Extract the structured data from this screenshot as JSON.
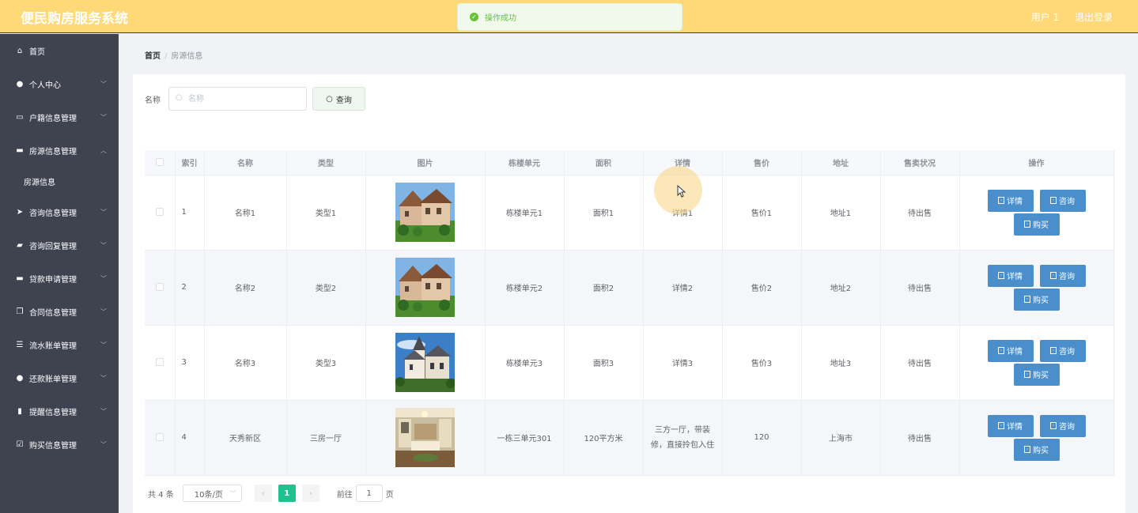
{
  "header": {
    "brand": "便民购房服务系统",
    "user": "用户 1",
    "logout": "退出登录"
  },
  "toast": {
    "message": "操作成功"
  },
  "sidebar": {
    "items": [
      {
        "label": "首页",
        "icon": "home-icon"
      },
      {
        "label": "个人中心",
        "icon": "user-icon"
      },
      {
        "label": "户籍信息管理",
        "icon": "chat-icon"
      },
      {
        "label": "房源信息管理",
        "icon": "monitor-icon",
        "expanded": true,
        "children": [
          "房源信息"
        ]
      },
      {
        "label": "咨询信息管理",
        "icon": "send-icon"
      },
      {
        "label": "咨询回复管理",
        "icon": "reply-icon"
      },
      {
        "label": "贷款申请管理",
        "icon": "loan-icon"
      },
      {
        "label": "合同信息管理",
        "icon": "copy-icon"
      },
      {
        "label": "流水账单管理",
        "icon": "list-icon"
      },
      {
        "label": "还款账单管理",
        "icon": "user-icon"
      },
      {
        "label": "提醒信息管理",
        "icon": "bell-icon"
      },
      {
        "label": "购买信息管理",
        "icon": "check-icon"
      }
    ]
  },
  "breadcrumb": {
    "home": "首页",
    "current": "房源信息"
  },
  "search": {
    "label": "名称",
    "placeholder": "名称",
    "button": "查询"
  },
  "table": {
    "columns": [
      "索引",
      "名称",
      "类型",
      "图片",
      "栋楼单元",
      "面积",
      "详情",
      "售价",
      "地址",
      "售卖状况",
      "操作"
    ],
    "rows": [
      {
        "index": "1",
        "name": "名称1",
        "type": "类型1",
        "image": "house-villa",
        "unit": "栋楼单元1",
        "area": "面积1",
        "detail": "详情1",
        "price": "售价1",
        "address": "地址1",
        "status": "待出售"
      },
      {
        "index": "2",
        "name": "名称2",
        "type": "类型2",
        "image": "house-villa",
        "unit": "栋楼单元2",
        "area": "面积2",
        "detail": "详情2",
        "price": "售价2",
        "address": "地址2",
        "status": "待出售"
      },
      {
        "index": "3",
        "name": "名称3",
        "type": "类型3",
        "image": "house-castle",
        "unit": "栋楼单元3",
        "area": "面积3",
        "detail": "详情3",
        "price": "售价3",
        "address": "地址3",
        "status": "待出售"
      },
      {
        "index": "4",
        "name": "天秀新区",
        "type": "三房一厅",
        "image": "house-interior",
        "unit": "一栋三单元301",
        "area": "120平方米",
        "detail": "三方一厅，带装修，直接拎包入住",
        "price": "120",
        "address": "上海市",
        "status": "待出售"
      }
    ],
    "actions": {
      "detail": "详情",
      "consult": "咨询",
      "buy": "购买"
    }
  },
  "pagination": {
    "total": "共 4 条",
    "page_size": "10条/页",
    "current_page": "1",
    "goto_label": "前往",
    "goto_value": "1",
    "page_suffix": "页"
  },
  "colors": {
    "header": "#ffd978",
    "sidebar": "#3f4350",
    "action_button": "#4a8fcb",
    "pager_active": "#1fc18e",
    "toast_success": "#67c23a"
  }
}
